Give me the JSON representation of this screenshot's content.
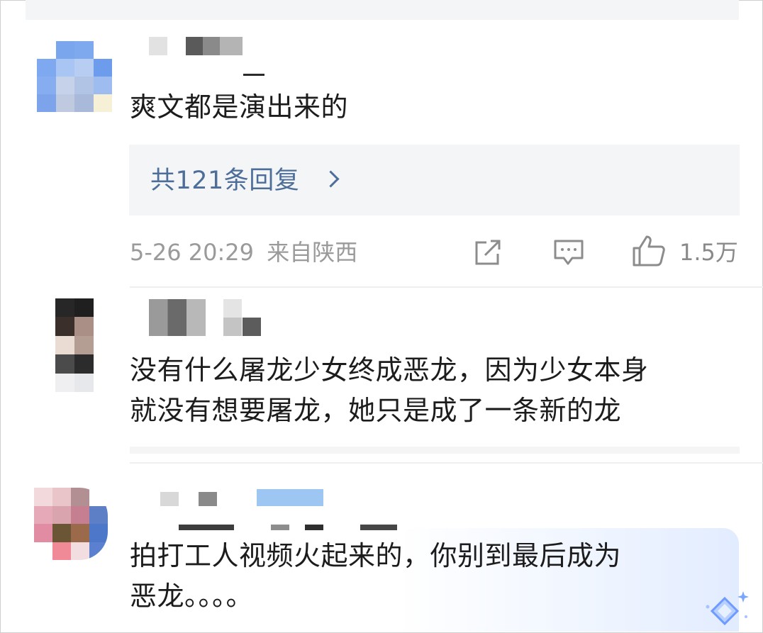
{
  "comments": [
    {
      "text": "爽文都是演出来的",
      "reply_link": "共121条回复",
      "timestamp": "5-26 20:29",
      "location": "来自陕西",
      "like_count": "1.5万"
    },
    {
      "text_line1": "没有什么屠龙少女终成恶龙，因为少女本身",
      "text_line2": "就没有想要屠龙，她只是成了一条新的龙"
    },
    {
      "text_line1": "拍打工人视频火起来的，你别到最后成为",
      "text_line2": "恶龙。。。。"
    }
  ],
  "icons": {
    "share": "share-icon",
    "comment": "comment-icon",
    "like": "thumbs-up-icon",
    "badge": "sparkle-badge-icon"
  },
  "colors": {
    "link": "#4e6e9a",
    "meta": "#9a9a9a",
    "reply_bg": "#f4f5f7"
  }
}
